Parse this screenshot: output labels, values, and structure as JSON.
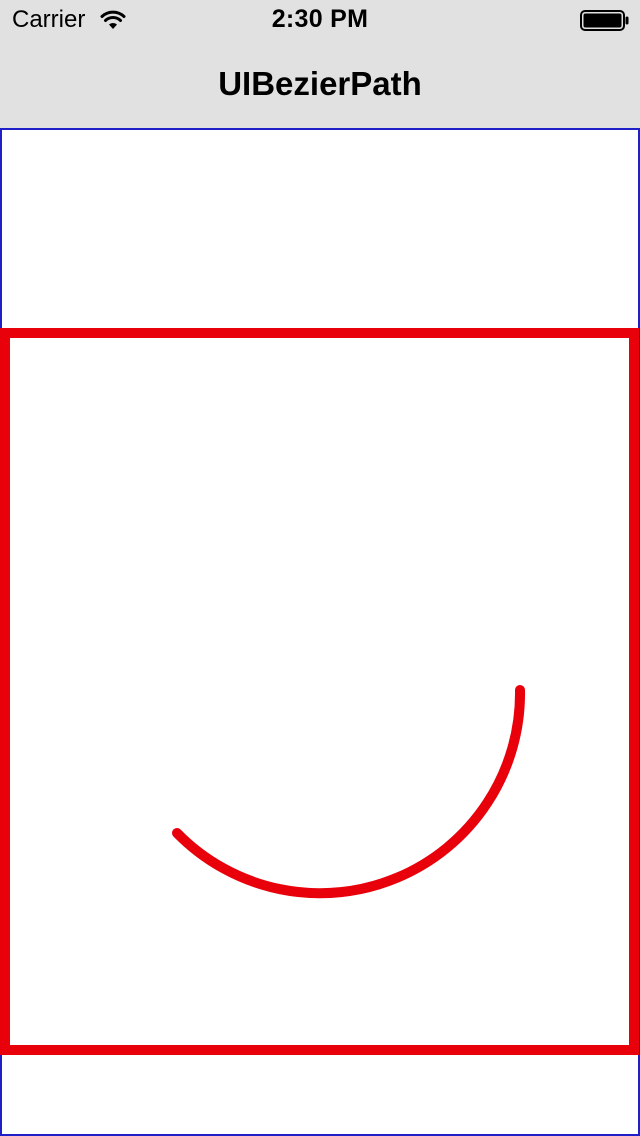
{
  "status_bar": {
    "carrier": "Carrier",
    "time": "2:30 PM",
    "wifi_icon": "wifi-icon",
    "battery_icon": "battery-full-icon"
  },
  "nav_bar": {
    "title": "UIBezierPath"
  },
  "canvas": {
    "border_color": "#1f1fc8",
    "shapes": [
      {
        "kind": "rectangle",
        "stroke": "#e8000b"
      },
      {
        "kind": "arc",
        "stroke": "#e8000b",
        "line_cap": "round"
      }
    ]
  },
  "colors": {
    "bar_background": "#e1e1e1",
    "accent_red": "#e8000b",
    "view_border": "#1f1fc8"
  }
}
